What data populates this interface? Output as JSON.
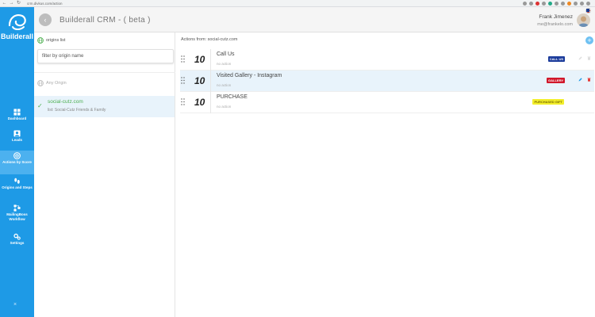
{
  "browser": {
    "url": "crm.divkus.com/action"
  },
  "sidebar": {
    "brand": "Builderall",
    "items": [
      {
        "label": "Dashboard",
        "icon": "dashboard-icon",
        "active": false
      },
      {
        "label": "Leads",
        "icon": "leads-icon",
        "active": false
      },
      {
        "label": "Actions by Score",
        "icon": "score-icon",
        "active": true
      },
      {
        "label": "Origins and Steps",
        "icon": "footsteps-icon",
        "active": false
      },
      {
        "label": "MailingBoss Workflow",
        "icon": "workflow-icon",
        "active": false
      },
      {
        "label": "Settings",
        "icon": "gears-icon",
        "active": false
      }
    ],
    "close_label": "×"
  },
  "header": {
    "back_label": "‹",
    "title": "Builderall CRM - ( beta )",
    "user_name": "Frank Jimenez",
    "user_email": "me@frankelo.com"
  },
  "origins": {
    "title": "origins list",
    "filter_placeholder": "filter by origin name",
    "any_origin": "Any Origin",
    "items": [
      {
        "name": "social-cutz.com",
        "sub": "list: Social-Cutz Friends & Family",
        "selected": true
      }
    ]
  },
  "actions": {
    "title": "Actions from: social-cutz.com",
    "add_label": "+",
    "rows": [
      {
        "score": "10",
        "title": "Call Us",
        "action": "no action",
        "badge": "CALL US"
      },
      {
        "score": "10",
        "title": "Visited Gallery - Instagram",
        "action": "no action",
        "badge": "GALLERY"
      },
      {
        "score": "10",
        "title": "PURCHASE",
        "action": "no action",
        "badge": "PURCHASED GIFT"
      }
    ]
  },
  "colors": {
    "sidebar": "#1e9ae6",
    "sidebar_active": "#4cb1ef",
    "selected_row": "#e8f3fb",
    "success": "#4caf50",
    "badge_call": "#1a3a9a",
    "badge_gallery": "#d1182b",
    "badge_purchase": "#f2ee2b"
  }
}
